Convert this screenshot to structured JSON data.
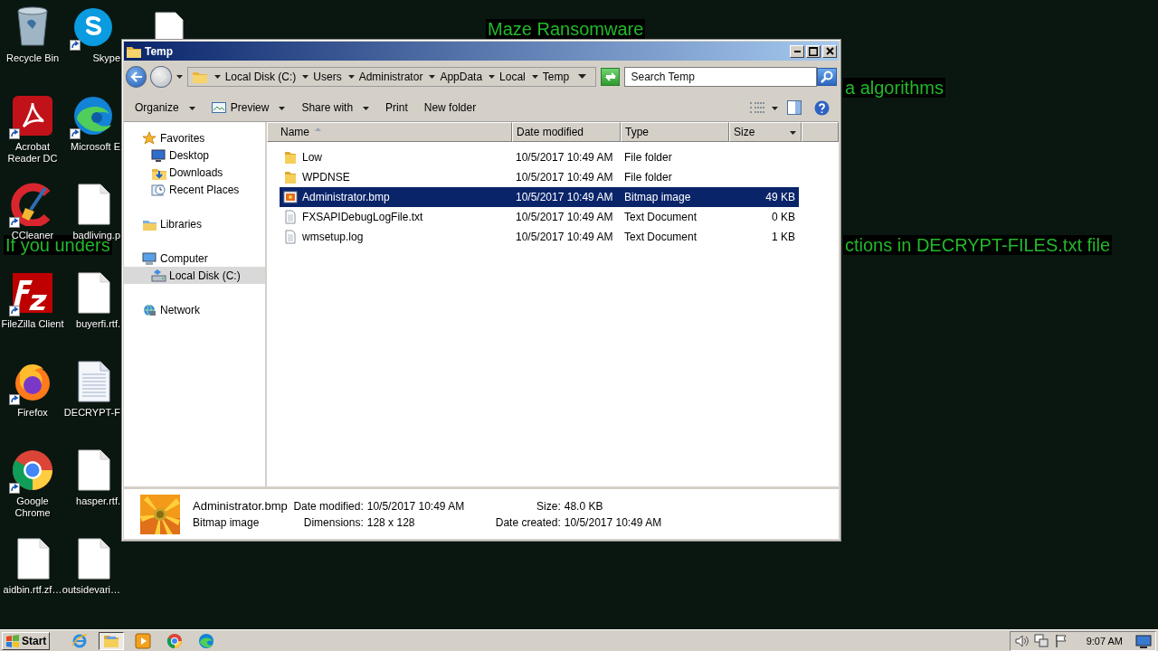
{
  "desktop": {
    "banners": [
      {
        "text": "Maze Ransomware"
      },
      {
        "text": "a algorithms"
      },
      {
        "text": "If you unders"
      },
      {
        "text": "ctions in DECRYPT-FILES.txt file"
      }
    ],
    "icons": [
      {
        "label": "Recycle Bin",
        "kind": "recycle",
        "shortcut": false
      },
      {
        "label": "Skype",
        "kind": "skype",
        "shortcut": true
      },
      {
        "label": "Acrobat Reader DC",
        "kind": "acrobat",
        "shortcut": true
      },
      {
        "label": "Microsoft E",
        "kind": "edge",
        "shortcut": true
      },
      {
        "label": "CCleaner",
        "kind": "ccleaner",
        "shortcut": true
      },
      {
        "label": "badliving.p",
        "kind": "file",
        "shortcut": false
      },
      {
        "label": "FileZilla Client",
        "kind": "filezilla",
        "shortcut": true
      },
      {
        "label": "buyerfi.rtf.",
        "kind": "file",
        "shortcut": false
      },
      {
        "label": "Firefox",
        "kind": "firefox",
        "shortcut": true
      },
      {
        "label": "DECRYPT-F",
        "kind": "textfile",
        "shortcut": false
      },
      {
        "label": "Google Chrome",
        "kind": "chrome",
        "shortcut": true
      },
      {
        "label": "hasper.rtf.",
        "kind": "file",
        "shortcut": false
      },
      {
        "label": "aidbin.rtf.zf…",
        "kind": "file",
        "shortcut": false
      },
      {
        "label": "outsidevari…",
        "kind": "file",
        "shortcut": false
      }
    ]
  },
  "window": {
    "title": "Temp",
    "breadcrumb": [
      "Local Disk (C:)",
      "Users",
      "Administrator",
      "AppData",
      "Local",
      "Temp"
    ],
    "search": {
      "placeholder": "Search Temp"
    },
    "toolbar": [
      {
        "label": "Organize",
        "kind": "menu"
      },
      {
        "label": "Preview",
        "kind": "preview"
      },
      {
        "label": "Share with",
        "kind": "menu"
      },
      {
        "label": "Print",
        "kind": "plain"
      },
      {
        "label": "New folder",
        "kind": "plain"
      }
    ],
    "sidebar": {
      "items": [
        {
          "label": "Favorites",
          "kind": "star",
          "selected": false,
          "children": [
            {
              "label": "Desktop",
              "kind": "desktop",
              "selected": false
            },
            {
              "label": "Downloads",
              "kind": "downloads",
              "selected": false
            },
            {
              "label": "Recent Places",
              "kind": "recent",
              "selected": false
            }
          ]
        },
        {
          "label": "Libraries",
          "kind": "libraries",
          "selected": false
        },
        {
          "label": "Computer",
          "kind": "computer",
          "selected": false,
          "children": [
            {
              "label": "Local Disk (C:)",
              "kind": "disk",
              "selected": true
            }
          ]
        },
        {
          "label": "Network",
          "kind": "network",
          "selected": false
        }
      ]
    },
    "table": {
      "columns": [
        {
          "label": "Name",
          "sorted": true
        },
        {
          "label": "Date modified",
          "sorted": false
        },
        {
          "label": "Type",
          "sorted": false
        },
        {
          "label": "Size",
          "sorted": false
        }
      ],
      "rows": [
        {
          "name": "Low",
          "kind": "folder",
          "date": "10/5/2017 10:49 AM",
          "type": "File folder",
          "selected": false
        },
        {
          "name": "WPDNSE",
          "kind": "folder",
          "date": "10/5/2017 10:49 AM",
          "type": "File folder",
          "selected": false
        },
        {
          "name": "Administrator.bmp",
          "kind": "bitmap",
          "date": "10/5/2017 10:49 AM",
          "type": "Bitmap image",
          "size": "49 KB",
          "selected": true
        },
        {
          "name": "FXSAPIDebugLogFile.txt",
          "kind": "text",
          "date": "10/5/2017 10:49 AM",
          "type": "Text Document",
          "size": "0 KB",
          "selected": false
        },
        {
          "name": "wmsetup.log",
          "kind": "text",
          "date": "10/5/2017 10:49 AM",
          "type": "Text Document",
          "size": "1 KB",
          "selected": false
        }
      ]
    },
    "details": {
      "name": "Administrator.bmp",
      "type": "Bitmap image",
      "fields": [
        {
          "label": "Date modified:",
          "value": "10/5/2017 10:49 AM"
        },
        {
          "label": "Size:",
          "value": "48.0 KB"
        },
        {
          "label": "Dimensions:",
          "value": "128 x 128"
        },
        {
          "label": "Date created:",
          "value": "10/5/2017 10:49 AM"
        }
      ]
    }
  },
  "taskbar": {
    "start": "Start",
    "apps": [
      {
        "kind": "ie",
        "active": false
      },
      {
        "kind": "explorer",
        "active": true
      },
      {
        "kind": "media",
        "active": false
      },
      {
        "kind": "chrome",
        "active": false
      },
      {
        "kind": "edge",
        "active": false
      }
    ],
    "clock": "9:07 AM"
  }
}
